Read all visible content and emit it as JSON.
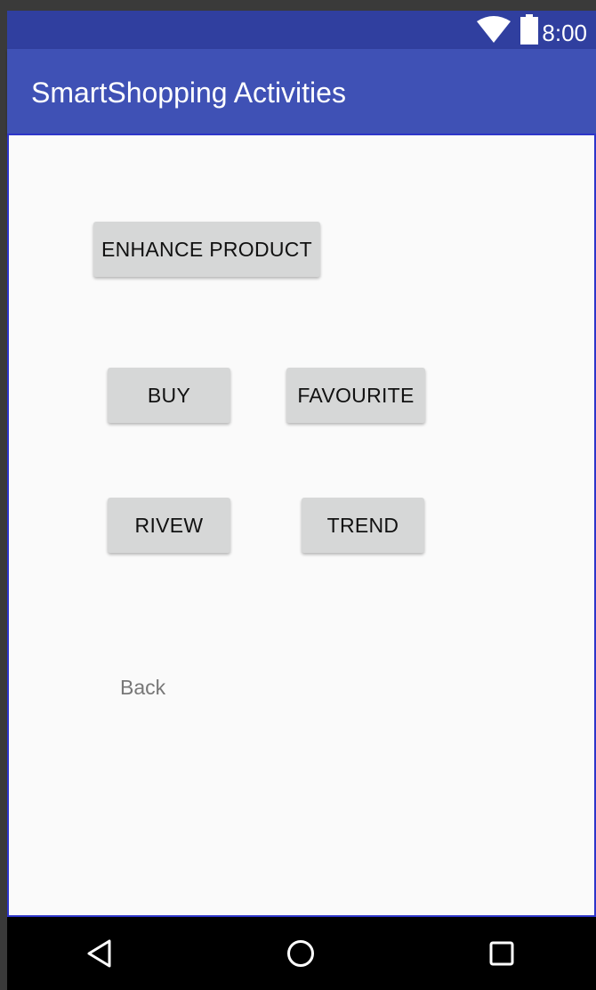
{
  "status_bar": {
    "time": "8:00",
    "wifi_icon": "wifi-icon",
    "battery_icon": "battery-icon",
    "background": "#303f9f"
  },
  "app_bar": {
    "title": "SmartShopping Activities",
    "background": "#3f51b5"
  },
  "buttons": {
    "enhance_product": "ENHANCE PRODUCT",
    "buy": "BUY",
    "favourite": "FAVOURITE",
    "review": "RIVEW",
    "trend": "TREND"
  },
  "back_link": "Back",
  "nav_bar": {
    "back_icon": "triangle-back-icon",
    "home_icon": "circle-home-icon",
    "recent_icon": "square-recents-icon"
  },
  "colors": {
    "accent_border": "#2d35c9",
    "button_bg": "#d6d7d7",
    "content_bg": "#fafafa"
  }
}
